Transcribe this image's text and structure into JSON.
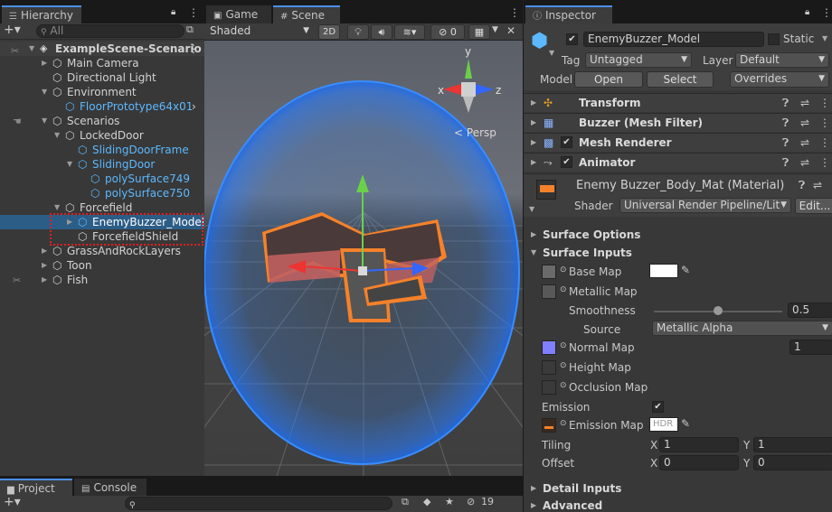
{
  "hierarchy": {
    "tab": "Hierarchy",
    "search_placeholder": "All",
    "scene_name": "ExampleScene-Scenario",
    "items": [
      {
        "label": "Main Camera"
      },
      {
        "label": "Directional Light"
      },
      {
        "label": "Environment"
      },
      {
        "label": "FloorPrototype64x01"
      },
      {
        "label": "Scenarios"
      },
      {
        "label": "LockedDoor"
      },
      {
        "label": "SlidingDoorFrame"
      },
      {
        "label": "SlidingDoor"
      },
      {
        "label": "polySurface749"
      },
      {
        "label": "polySurface750"
      },
      {
        "label": "Forcefield"
      },
      {
        "label": "EnemyBuzzer_Model"
      },
      {
        "label": "ForcefieldShield"
      },
      {
        "label": "GrassAndRockLayers"
      },
      {
        "label": "Toon"
      },
      {
        "label": "Fish"
      }
    ]
  },
  "scene": {
    "tab_game": "Game",
    "tab_scene": "Scene",
    "shading": "Shaded",
    "mode_2d": "2D",
    "hidden_count": "0",
    "persp_label": "Persp",
    "gizmo_x": "x",
    "gizmo_y": "y",
    "gizmo_z": "z"
  },
  "bottom": {
    "tab_project": "Project",
    "tab_console": "Console",
    "count": "19"
  },
  "inspector": {
    "tab": "Inspector",
    "object_name": "EnemyBuzzer_Model",
    "static_label": "Static",
    "tag_label": "Tag",
    "tag_value": "Untagged",
    "layer_label": "Layer",
    "layer_value": "Default",
    "model_label": "Model",
    "open_label": "Open",
    "select_label": "Select",
    "overrides_label": "Overrides",
    "components": [
      {
        "name": "Transform"
      },
      {
        "name": "Buzzer (Mesh Filter)"
      },
      {
        "name": "Mesh Renderer"
      },
      {
        "name": "Animator"
      }
    ],
    "material_name": "Enemy Buzzer_Body_Mat (Material)",
    "shader_label": "Shader",
    "shader_value": "Universal Render Pipeline/Lit",
    "edit_label": "Edit...",
    "surface_options": "Surface Options",
    "surface_inputs": "Surface Inputs",
    "base_map": "Base Map",
    "metallic_map": "Metallic Map",
    "smoothness_label": "Smoothness",
    "smoothness_value": "0.5",
    "source_label": "Source",
    "source_value": "Metallic Alpha",
    "normal_map": "Normal Map",
    "normal_value": "1",
    "height_map": "Height Map",
    "occlusion_map": "Occlusion Map",
    "emission_label": "Emission",
    "emission_map": "Emission Map",
    "hdr_label": "HDR",
    "tiling_label": "Tiling",
    "offset_label": "Offset",
    "tiling_x": "1",
    "tiling_y": "1",
    "offset_x": "0",
    "offset_y": "0",
    "axis_x": "X",
    "axis_y": "Y",
    "detail_inputs": "Detail Inputs",
    "advanced": "Advanced"
  },
  "colors": {
    "selection": "#2c5d87",
    "prefab_text": "#5cb8ff",
    "accent": "#4a8fe8"
  }
}
